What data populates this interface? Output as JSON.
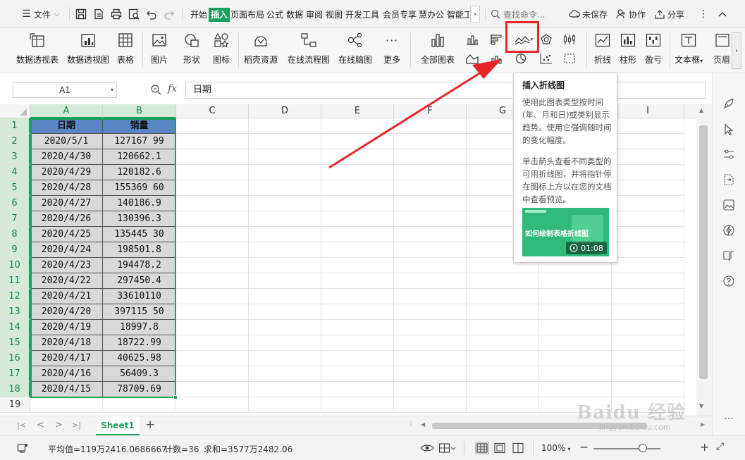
{
  "menubar": {
    "file_label": "文件",
    "tabs": [
      "开始",
      "插入",
      "页面布局",
      "公式",
      "数据",
      "审阅",
      "视图",
      "开发工具",
      "会员专享",
      "慧办公",
      "智能工"
    ],
    "active_tab": "插入",
    "search_placeholder": "查找命令...",
    "unsaved_label": "未保存",
    "collab_label": "协作",
    "share_label": "分享"
  },
  "ribbon": {
    "pivot_table": "数据透视表",
    "pivot_chart": "数据透视图",
    "table": "表格",
    "picture": "图片",
    "shape": "形状",
    "icon": "图标",
    "daoke": "稻壳资源",
    "flowchart": "在线流程图",
    "mindmap": "在线脑图",
    "more": "更多",
    "all_charts": "全部图表",
    "sparkline_line": "折线",
    "sparkline_column": "柱形",
    "sparkline_winloss": "盈亏",
    "textbox": "文本框",
    "header_footer": "页眉"
  },
  "formula_bar": {
    "cell_ref": "A1",
    "fx": "fx",
    "content": "日期"
  },
  "grid": {
    "columns": [
      "A",
      "B",
      "C",
      "D",
      "E",
      "F",
      "G",
      "H",
      "I"
    ],
    "rows": [
      "1",
      "2",
      "3",
      "4",
      "5",
      "6",
      "7",
      "8",
      "9",
      "10",
      "11",
      "12",
      "13",
      "14",
      "15",
      "16",
      "17",
      "18",
      "19"
    ],
    "headers": [
      "日期",
      "销量"
    ],
    "data": [
      [
        "2020/5/1",
        "127167 99"
      ],
      [
        "2020/4/30",
        "120662.1"
      ],
      [
        "2020/4/29",
        "120182.6"
      ],
      [
        "2020/4/28",
        "155369 60"
      ],
      [
        "2020/4/27",
        "140186.9"
      ],
      [
        "2020/4/26",
        "130396.3"
      ],
      [
        "2020/4/25",
        "135445 30"
      ],
      [
        "2020/4/24",
        "198501.8"
      ],
      [
        "2020/4/23",
        "194478.2"
      ],
      [
        "2020/4/22",
        "297450.4"
      ],
      [
        "2020/4/21",
        "33610110"
      ],
      [
        "2020/4/20",
        "397115 50"
      ],
      [
        "2020/4/19",
        "18997.8"
      ],
      [
        "2020/4/18",
        "18722.99"
      ],
      [
        "2020/4/17",
        "40625.98"
      ],
      [
        "2020/4/16",
        "56409.3"
      ],
      [
        "2020/4/15",
        "78709.69"
      ]
    ]
  },
  "sheet": {
    "active_sheet": "Sheet1"
  },
  "statusbar": {
    "average": "平均值=119万2416.0686667",
    "count": "计数=36",
    "sum": "求和=3577万2482.06",
    "zoom": "100%"
  },
  "tooltip": {
    "title": "插入折线图",
    "desc1": "使用此图表类型按时间(年、月和日)或类别显示趋势。使用它强调随时间的变化幅度。",
    "desc2": "单击箭头查看不同类型的可用折线图，并将指针停在图标上方以在您的文档中查看预览。",
    "video_title": "如何绘制表格折线图",
    "video_duration": "01:08"
  },
  "colors": {
    "accent": "#1aa05e",
    "header_fill": "#5b86c5",
    "data_fill": "#d9d9d9",
    "annotation": "#e8262a"
  }
}
